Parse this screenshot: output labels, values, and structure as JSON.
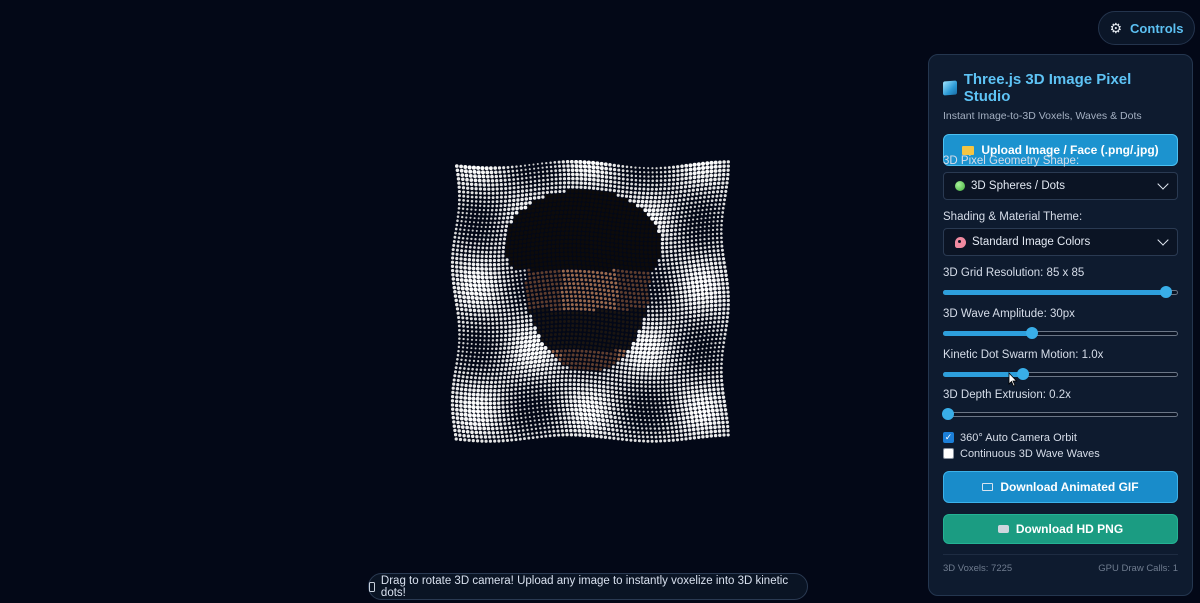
{
  "controls_toggle": {
    "icon": "gear-icon",
    "label": "Controls"
  },
  "panel": {
    "icon": "cube-icon",
    "title": "Three.js 3D Image Pixel Studio",
    "subtitle": "Instant Image-to-3D Voxels, Waves & Dots",
    "upload_button": {
      "icon": "folder-icon",
      "label": "Upload Image / Face (.png/.jpg)"
    },
    "geometry": {
      "label": "3D Pixel Geometry Shape:",
      "icon": "green-sphere-icon",
      "selected": "3D Spheres / Dots"
    },
    "material": {
      "label": "Shading & Material Theme:",
      "icon": "palette-icon",
      "selected": "Standard Image Colors"
    },
    "sliders": [
      {
        "label": "3D Grid Resolution: 85 x 85",
        "level_percent": 95
      },
      {
        "label": "3D Wave Amplitude: 30px",
        "level_percent": 38
      },
      {
        "label": "Kinetic Dot Swarm Motion: 1.0x",
        "level_percent": 34
      },
      {
        "label": "3D Depth Extrusion: 0.2x",
        "level_percent": 2
      }
    ],
    "checkboxes": [
      {
        "label": "360° Auto Camera Orbit",
        "checked": true
      },
      {
        "label": "Continuous 3D Wave Waves",
        "checked": false
      }
    ],
    "gif_button": {
      "icon": "film-icon",
      "label": "Download Animated GIF"
    },
    "png_button": {
      "icon": "camera-icon",
      "label": "Download HD PNG"
    },
    "stats": {
      "voxels": "3D Voxels: 7225",
      "draw_calls": "GPU Draw Calls: 1"
    }
  },
  "hint": {
    "icon": "phone-icon",
    "text": "Drag to rotate 3D camera! Upload any image to instantly voxelize into 3D kinetic dots!"
  },
  "colors": {
    "background": "#030817",
    "accent": "#2d9fdc",
    "title": "#5ec3f5",
    "png_button": "#1b9c82"
  }
}
